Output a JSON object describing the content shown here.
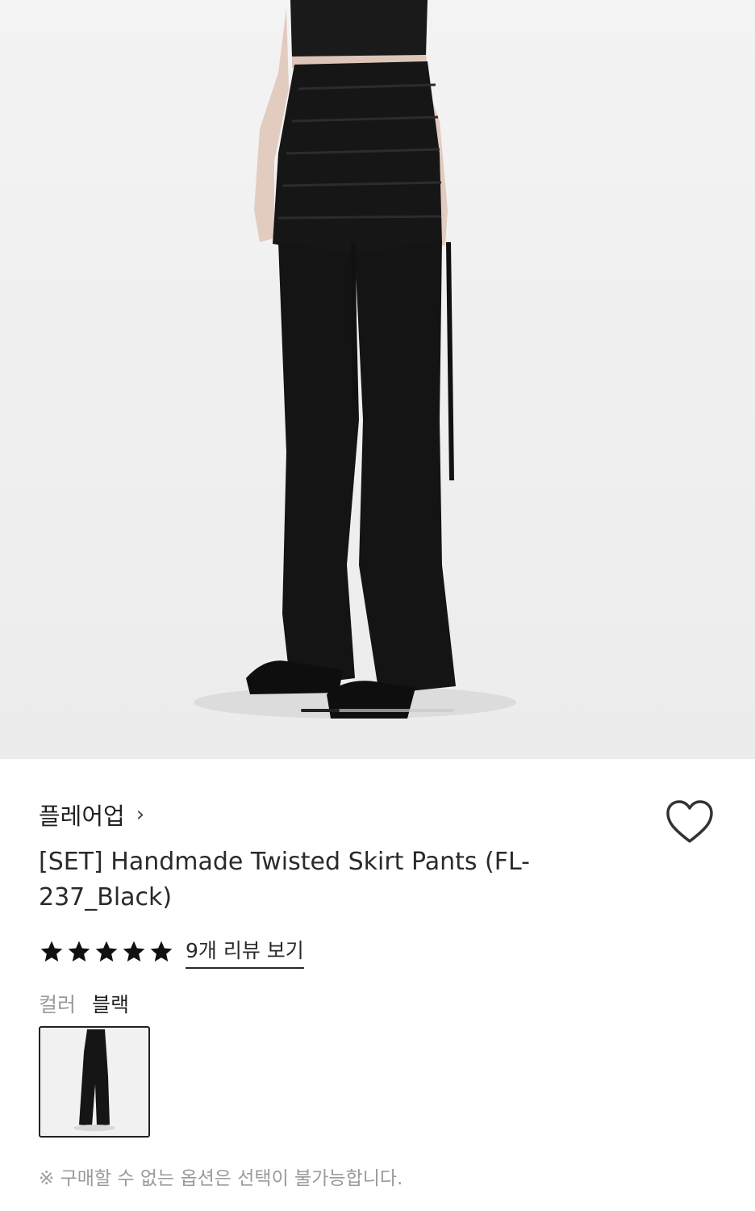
{
  "hero": {
    "image_icon": "product-photo-black-twisted-skirt-pants",
    "slides_total": 4,
    "slide_current": 1
  },
  "product": {
    "brand": "플레어업",
    "brand_chevron": "›",
    "title": "[SET] Handmade Twisted Skirt Pants (FL-237_Black)",
    "rating": 5,
    "review_link": "9개 리뷰 보기",
    "wishlist_icon": "heart-outline-icon"
  },
  "options": {
    "color_label": "컬러",
    "color_value": "블랙",
    "swatch_icon": "thumbnail-black-pants"
  },
  "notice": "※ 구매할 수 없는 옵션은 선택이 불가능합니다.",
  "colors": {
    "text": "#222222",
    "muted": "#9a9a9a",
    "garment": "#151515",
    "background": "#f0f0f0"
  }
}
